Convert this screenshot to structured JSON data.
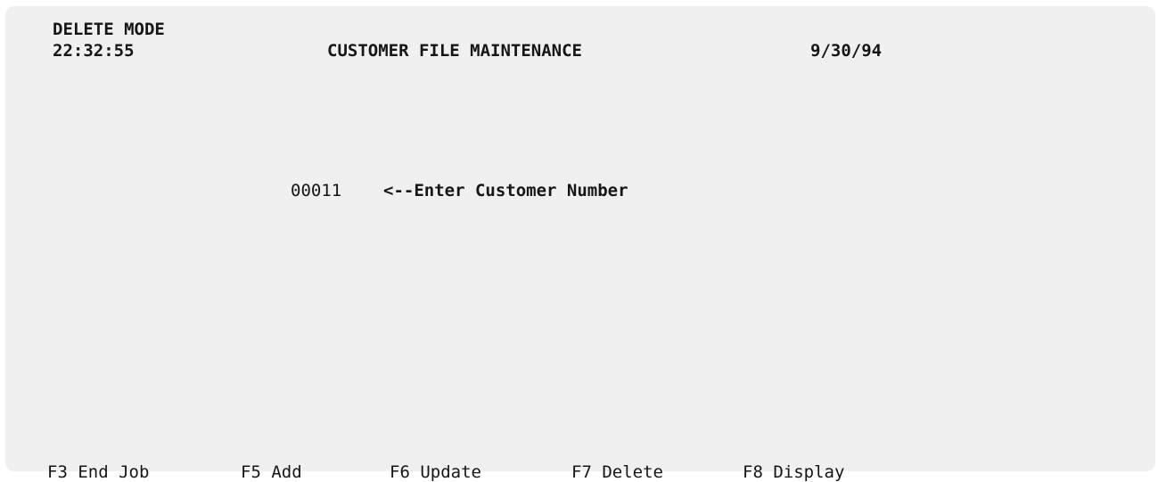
{
  "header": {
    "mode": "DELETE MODE",
    "time": "22:32:55",
    "title": "CUSTOMER FILE MAINTENANCE",
    "date": "9/30/94"
  },
  "form": {
    "customer_number": "00011",
    "prompt": "<--Enter Customer Number"
  },
  "function_keys": [
    {
      "label": "F3 End Job"
    },
    {
      "label": "F5 Add"
    },
    {
      "label": "F6 Update"
    },
    {
      "label": "F7 Delete"
    },
    {
      "label": "F8 Display"
    }
  ],
  "colors": {
    "screen_background": "#f0f0f0",
    "text": "#161616"
  }
}
